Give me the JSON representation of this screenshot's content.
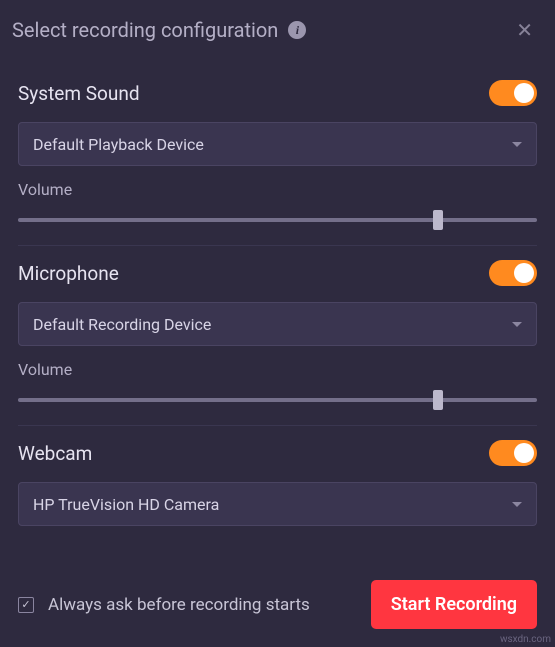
{
  "header": {
    "title": "Select recording configuration"
  },
  "system_sound": {
    "title": "System Sound",
    "device": "Default Playback Device",
    "volume_label": "Volume",
    "volume": 80,
    "enabled": true
  },
  "microphone": {
    "title": "Microphone",
    "device": "Default Recording Device",
    "volume_label": "Volume",
    "volume": 80,
    "enabled": true
  },
  "webcam": {
    "title": "Webcam",
    "device": "HP TrueVision HD Camera",
    "enabled": true
  },
  "footer": {
    "ask_label": "Always ask before recording starts",
    "ask_checked": true,
    "start_label": "Start Recording"
  },
  "watermark": "wsxdn.com"
}
